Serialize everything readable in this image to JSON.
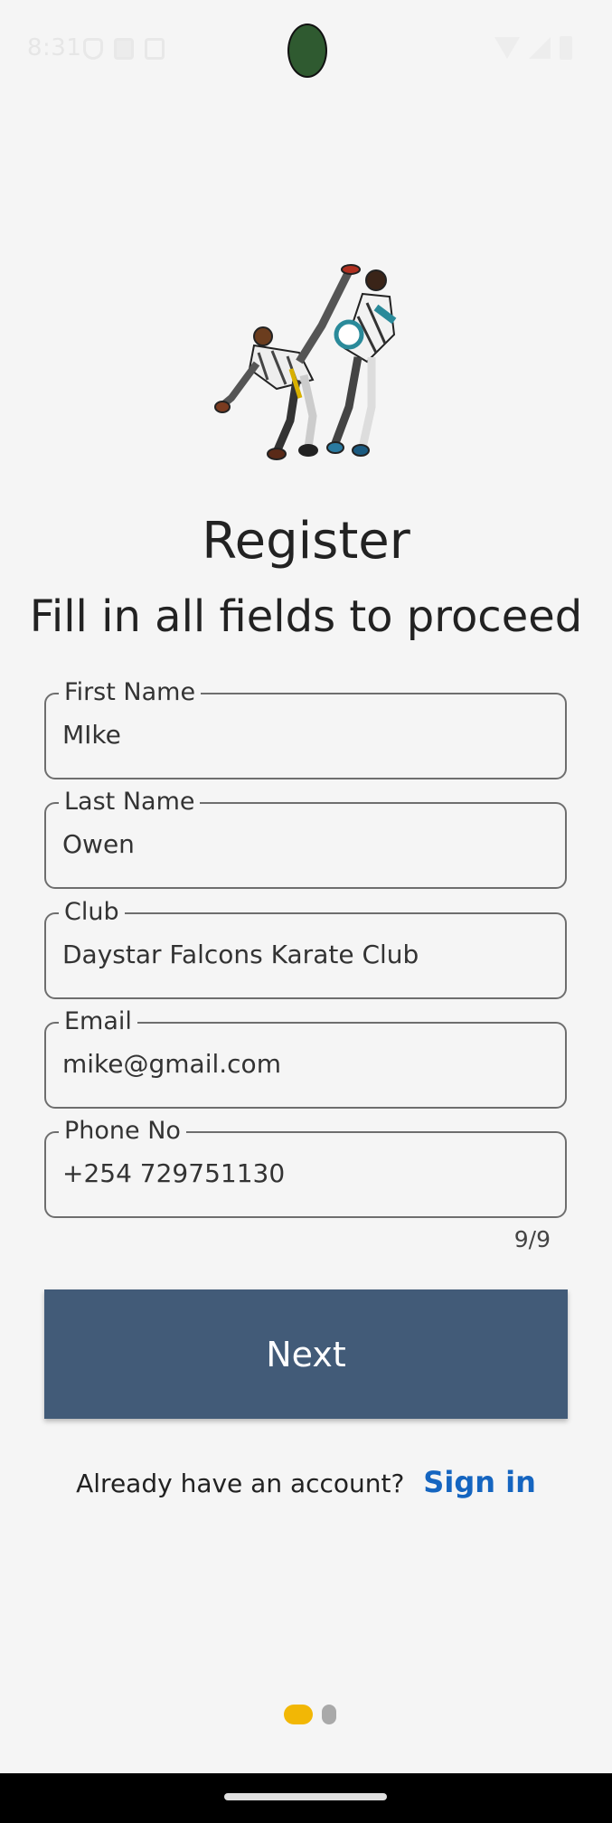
{
  "status": {
    "time": "8:31"
  },
  "register": {
    "title": "Register",
    "subtitle": "Fill in all fields to proceed"
  },
  "fields": [
    {
      "label": "First Name",
      "value": "MIke"
    },
    {
      "label": "Last Name",
      "value": "Owen"
    },
    {
      "label": "Club",
      "value": "Daystar Falcons Karate Club"
    },
    {
      "label": "Email",
      "value": "mike@gmail.com"
    },
    {
      "label": "Phone No",
      "value": "+254 729751130"
    }
  ],
  "phone_counter": "9/9",
  "next_button": "Next",
  "signin": {
    "prompt": "Already have an account?",
    "link": "Sign in"
  },
  "pager": {
    "total": 2,
    "active": 1
  },
  "colors": {
    "button": "#425b78",
    "link": "#1565c0",
    "active_dot": "#f2b705"
  }
}
